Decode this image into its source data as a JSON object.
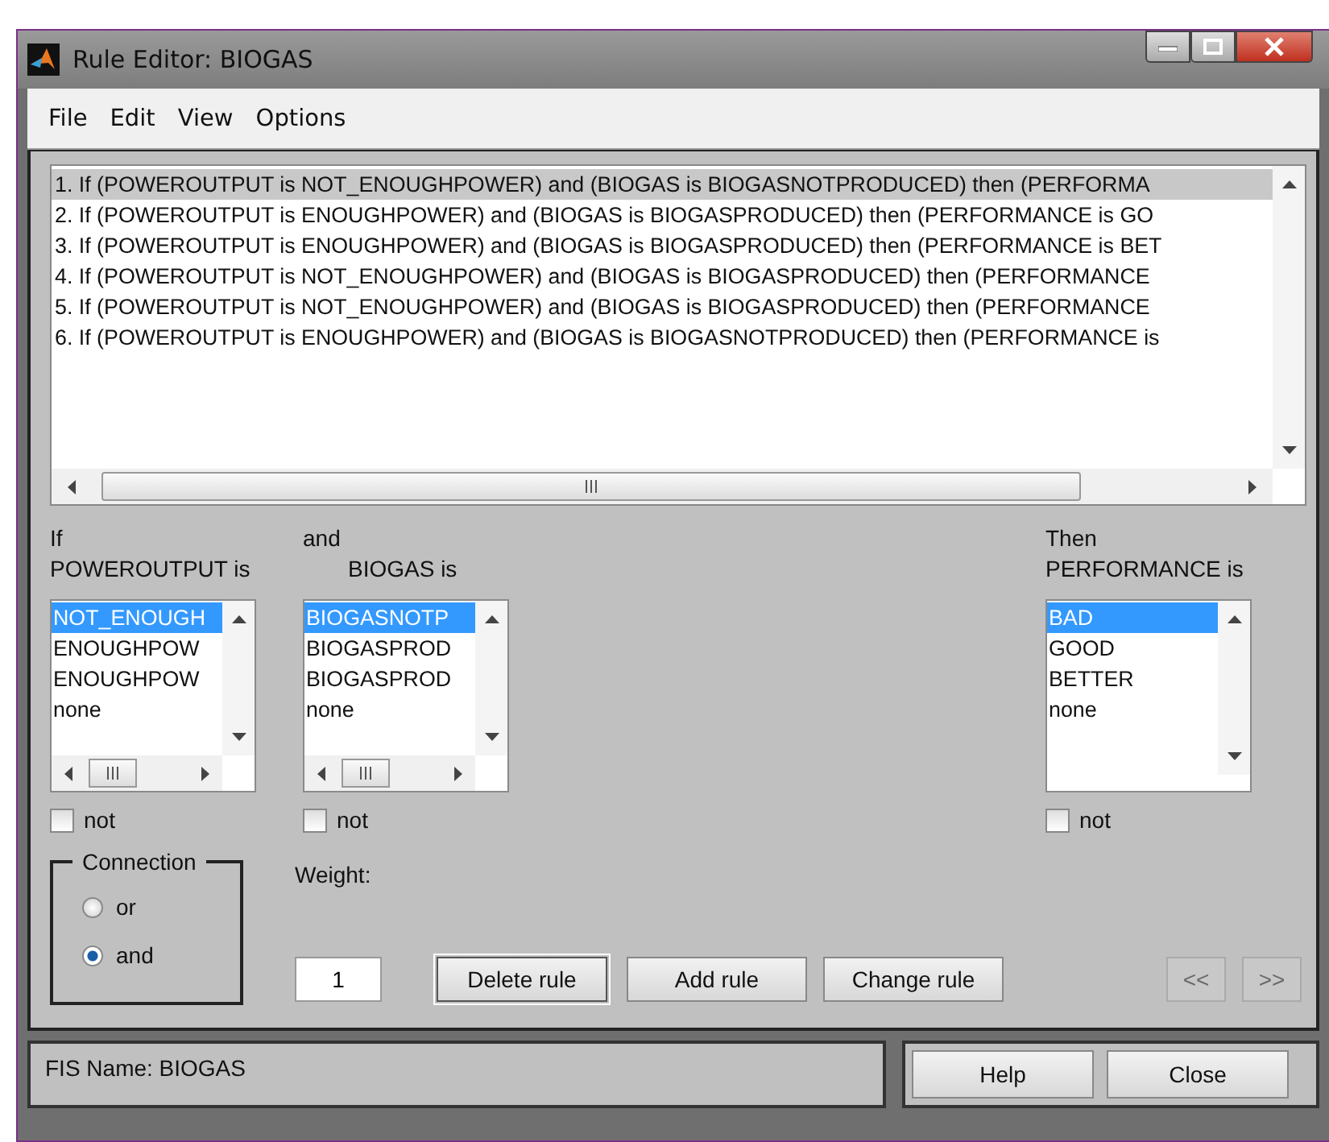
{
  "window": {
    "title": "Rule Editor: BIOGAS"
  },
  "menu": [
    "File",
    "Edit",
    "View",
    "Options"
  ],
  "rules": [
    {
      "text": "1. If (POWEROUTPUT is NOT_ENOUGHPOWER) and (BIOGAS is BIOGASNOTPRODUCED) then (PERFORMA",
      "selected": true
    },
    {
      "text": "2. If (POWEROUTPUT is ENOUGHPOWER) and (BIOGAS is BIOGASPRODUCED) then (PERFORMANCE is GO",
      "selected": false
    },
    {
      "text": "3. If (POWEROUTPUT is ENOUGHPOWER) and (BIOGAS is BIOGASPRODUCED) then (PERFORMANCE is BET",
      "selected": false
    },
    {
      "text": "4. If (POWEROUTPUT is NOT_ENOUGHPOWER) and (BIOGAS is BIOGASPRODUCED) then (PERFORMANCE",
      "selected": false
    },
    {
      "text": "5. If (POWEROUTPUT is NOT_ENOUGHPOWER) and (BIOGAS is BIOGASPRODUCED) then (PERFORMANCE",
      "selected": false
    },
    {
      "text": "6. If (POWEROUTPUT is ENOUGHPOWER) and (BIOGAS is BIOGASNOTPRODUCED) then (PERFORMANCE is",
      "selected": false
    }
  ],
  "inputs": [
    {
      "kind": "antecedent",
      "label": "If",
      "variable": "POWEROUTPUT is",
      "not": false,
      "not_label": "not",
      "options": [
        {
          "text": "NOT_ENOUGH",
          "selected": true
        },
        {
          "text": "ENOUGHPOW",
          "selected": false
        },
        {
          "text": "ENOUGHPOW",
          "selected": false
        },
        {
          "text": "none",
          "selected": false
        }
      ]
    },
    {
      "kind": "antecedent",
      "label": "and",
      "variable": "BIOGAS is",
      "not": false,
      "not_label": "not",
      "options": [
        {
          "text": "BIOGASNOTP",
          "selected": true
        },
        {
          "text": "BIOGASPROD",
          "selected": false
        },
        {
          "text": "BIOGASPROD",
          "selected": false
        },
        {
          "text": "none",
          "selected": false
        }
      ]
    },
    {
      "kind": "consequent",
      "label": "Then",
      "variable": "PERFORMANCE is",
      "not": false,
      "not_label": "not",
      "options": [
        {
          "text": "BAD",
          "selected": true
        },
        {
          "text": "GOOD",
          "selected": false
        },
        {
          "text": "BETTER",
          "selected": false
        },
        {
          "text": "none",
          "selected": false
        }
      ]
    }
  ],
  "connection": {
    "title": "Connection",
    "options": [
      {
        "label": "or",
        "selected": false
      },
      {
        "label": "and",
        "selected": true
      }
    ]
  },
  "weight": {
    "label": "Weight:",
    "value": "1"
  },
  "actions": [
    {
      "label": "Delete rule",
      "focused": true
    },
    {
      "label": "Add rule",
      "focused": false
    },
    {
      "label": "Change rule",
      "focused": false
    }
  ],
  "nav": [
    {
      "label": "<<",
      "disabled": true
    },
    {
      "label": ">>",
      "disabled": true
    }
  ],
  "status": "FIS Name: BIOGAS",
  "footer": [
    "Help",
    "Close"
  ]
}
